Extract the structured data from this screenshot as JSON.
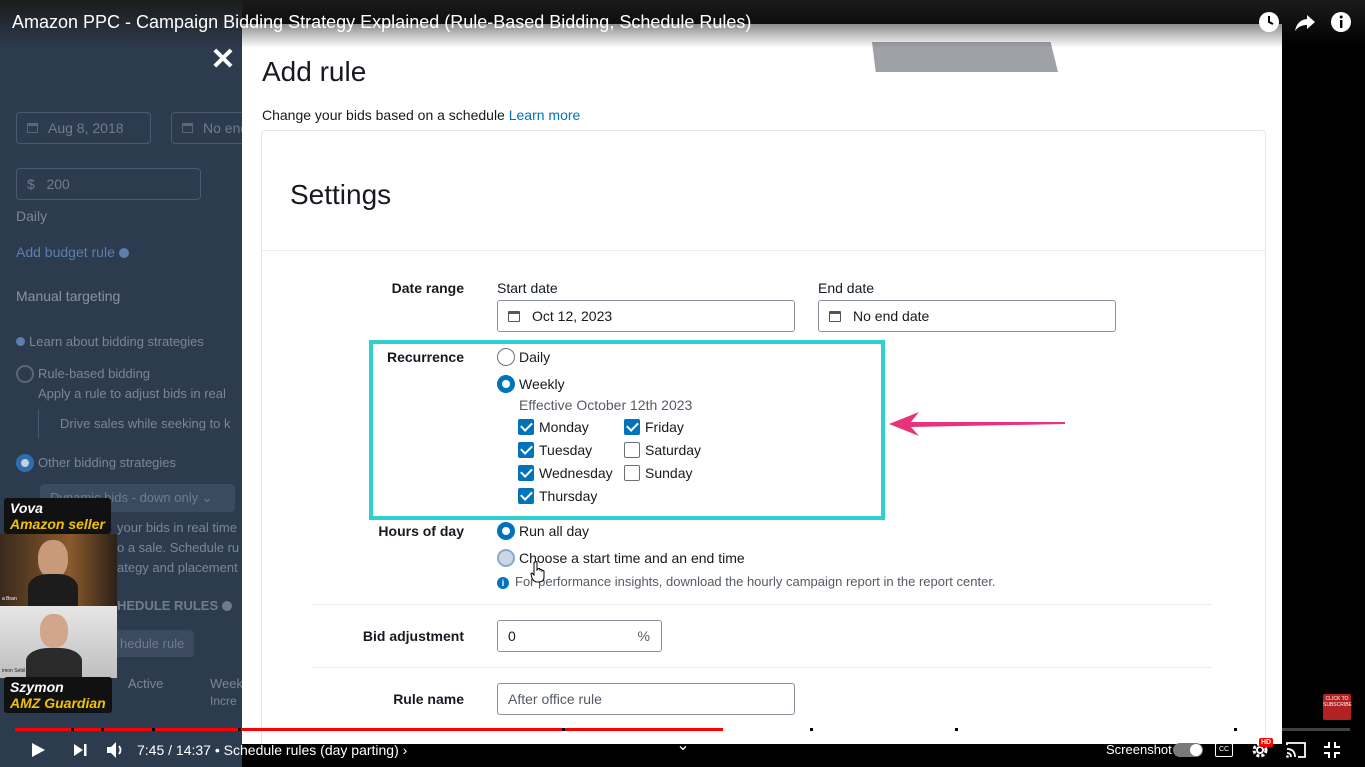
{
  "video": {
    "title": "Amazon PPC - Campaign Bidding Strategy Explained (Rule-Based Bidding, Schedule Rules)",
    "time_current": "7:45",
    "time_total": "14:37",
    "chapter": "Schedule rules (day parting)",
    "progress_played": 0.53,
    "progress_buffered": 0.6,
    "screenshot_label": "Screenshot",
    "hd_badge": "HD",
    "subscribe_badge": "CLICK TO SUBSCRIBE"
  },
  "background_page": {
    "start_date": "Aug 8, 2018",
    "end_date": "No end",
    "budget_currency": "$",
    "budget_value": "200",
    "budget_period": "Daily",
    "add_budget_rule": "Add budget rule",
    "manual_targeting": "Manual targeting",
    "learn_bidding": "Learn about bidding strategies",
    "rule_based_bidding": "Rule-based bidding",
    "rule_based_desc": "Apply a rule to adjust bids in real",
    "drive_sales": "Drive sales while seeking to k",
    "other_bidding": "Other bidding strategies",
    "dynamic_bids": "Dynamic bids - down only",
    "bids_realtime": "your bids in real time",
    "to_sale": "o a sale. Schedule ru",
    "strategy_placement": "ategy and placement",
    "schedule_rules": "HEDULE RULES",
    "schedule_rule_btn": "hedule rule",
    "col_active": "Active",
    "col_week": "Week",
    "col_incr": "Incre"
  },
  "webcams": [
    {
      "name": "Vova",
      "role": "Amazon seller",
      "caption": "a Bran"
    },
    {
      "name": "Szymon",
      "role": "AMZ Guardian",
      "caption": "imon Sebil"
    }
  ],
  "modal": {
    "close_label": "✕",
    "title": "Add rule",
    "subtitle": "Change your bids based on a schedule",
    "learn_more": "Learn more",
    "settings_title": "Settings",
    "date_range_label": "Date range",
    "start_date_label": "Start date",
    "start_date_value": "Oct 12, 2023",
    "end_date_label": "End date",
    "end_date_value": "No end date",
    "recurrence_label": "Recurrence",
    "recurrence_daily": "Daily",
    "recurrence_weekly": "Weekly",
    "effective_text": "Effective October 12th 2023",
    "days": {
      "monday": "Monday",
      "tuesday": "Tuesday",
      "wednesday": "Wednesday",
      "thursday": "Thursday",
      "friday": "Friday",
      "saturday": "Saturday",
      "sunday": "Sunday"
    },
    "days_checked": {
      "monday": true,
      "tuesday": true,
      "wednesday": true,
      "thursday": true,
      "friday": true,
      "saturday": false,
      "sunday": false
    },
    "hours_label": "Hours of day",
    "hours_all": "Run all day",
    "hours_custom": "Choose a start time and an end time",
    "hours_hint": "For performance insights, download the hourly campaign report in the report center.",
    "bid_adjustment_label": "Bid adjustment",
    "bid_adjustment_value": "0",
    "bid_adjustment_unit": "%",
    "rule_name_label": "Rule name",
    "rule_name_value": "After office rule"
  },
  "colors": {
    "highlight": "#2ecfd1",
    "arrow": "#e8337a",
    "accent": "#0073bb",
    "progress": "#ff0000"
  }
}
